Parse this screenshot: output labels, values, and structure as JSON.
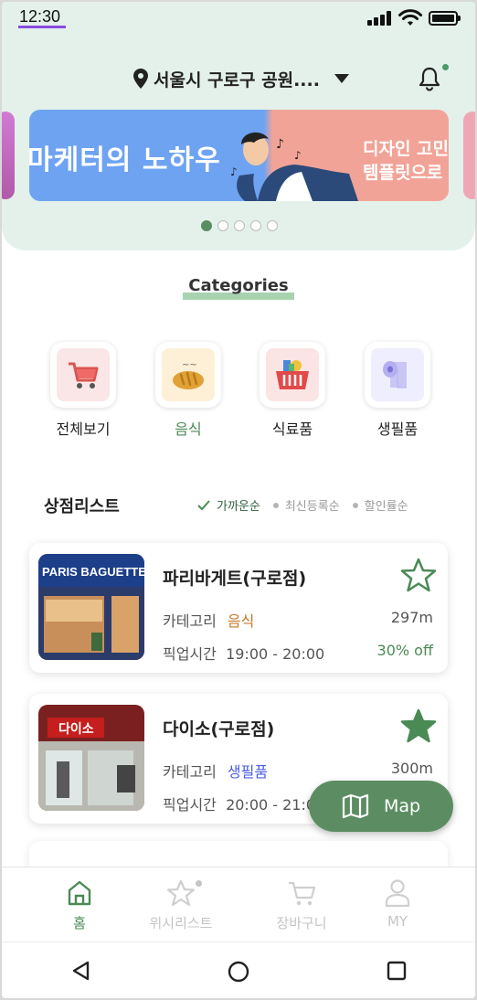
{
  "status_bar": {
    "time": "12:30"
  },
  "header": {
    "location": "서울시 구로구 공원....",
    "banner": {
      "left_text": "마케터의 노하우",
      "right_text": "디자인 고민\n템플릿으로",
      "page_count": 5,
      "active_index": 0
    }
  },
  "categories": {
    "title": "Categories",
    "items": [
      {
        "label": "전체보기",
        "icon": "shopping-cart-icon",
        "bg": "#fae6e6"
      },
      {
        "label": "음식",
        "icon": "bread-icon",
        "bg": "#fdf0d6",
        "active": true
      },
      {
        "label": "식료품",
        "icon": "grocery-basket-icon",
        "bg": "#fbe4e4"
      },
      {
        "label": "생필품",
        "icon": "toilet-paper-icon",
        "bg": "#eeeefe"
      }
    ]
  },
  "store_list": {
    "title": "상점리스트",
    "sort": [
      {
        "label": "가까운순",
        "active": true
      },
      {
        "label": "최신등록순",
        "active": false
      },
      {
        "label": "할인률순",
        "active": false
      }
    ],
    "stores": [
      {
        "name": "파리바게트(구로점)",
        "category_label": "카테고리",
        "category": "음식",
        "category_color": "#c4772a",
        "pickup_label": "픽업시간",
        "pickup_time": "19:00 - 20:00",
        "distance": "297m",
        "discount": "30% off",
        "favorite": false,
        "image_sign": "PARIS BAGUETTE"
      },
      {
        "name": "다이소(구로점)",
        "category_label": "카테고리",
        "category": "생필품",
        "category_color": "#4a5fe0",
        "pickup_label": "픽업시간",
        "pickup_time": "20:00 - 21:00",
        "distance": "300m",
        "discount": "",
        "favorite": true,
        "image_sign": "다이소"
      }
    ]
  },
  "map_button": {
    "label": "Map"
  },
  "bottom_nav": {
    "items": [
      {
        "label": "홈",
        "icon": "home-icon",
        "active": true
      },
      {
        "label": "위시리스트",
        "icon": "star-icon",
        "active": false
      },
      {
        "label": "장바구니",
        "icon": "cart-icon",
        "active": false
      },
      {
        "label": "MY",
        "icon": "user-icon",
        "active": false
      }
    ]
  },
  "colors": {
    "accent": "#5c8d62",
    "header_bg": "#e3f1ea"
  }
}
